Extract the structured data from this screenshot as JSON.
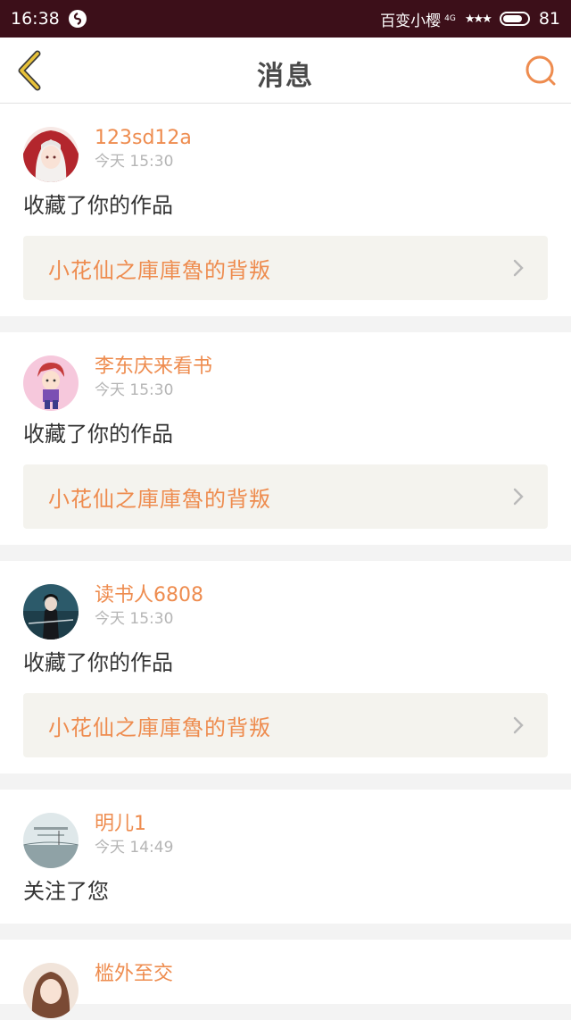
{
  "status_bar": {
    "time": "16:38",
    "carrier": "百变小樱",
    "network": "4G",
    "signal": "★★★",
    "battery": "81"
  },
  "header": {
    "title": "消息"
  },
  "messages": [
    {
      "username": "123sd12a",
      "time": "今天 15:30",
      "action": "收藏了你的作品",
      "work_title": "小花仙之庫庫魯的背叛"
    },
    {
      "username": "李东庆来看书",
      "time": "今天 15:30",
      "action": "收藏了你的作品",
      "work_title": "小花仙之庫庫魯的背叛"
    },
    {
      "username": "读书人6808",
      "time": "今天 15:30",
      "action": "收藏了你的作品",
      "work_title": "小花仙之庫庫魯的背叛"
    },
    {
      "username": "明儿1",
      "time": "今天 14:49",
      "action": "关注了您"
    },
    {
      "username": "槛外至交"
    }
  ],
  "colors": {
    "accent": "#ee8c4f",
    "status_bar": "#3c0f19",
    "back_icon": "#e8c23a"
  },
  "icons": {
    "back": "chevron-left-icon",
    "search": "search-icon",
    "more": "chevron-right-icon"
  }
}
